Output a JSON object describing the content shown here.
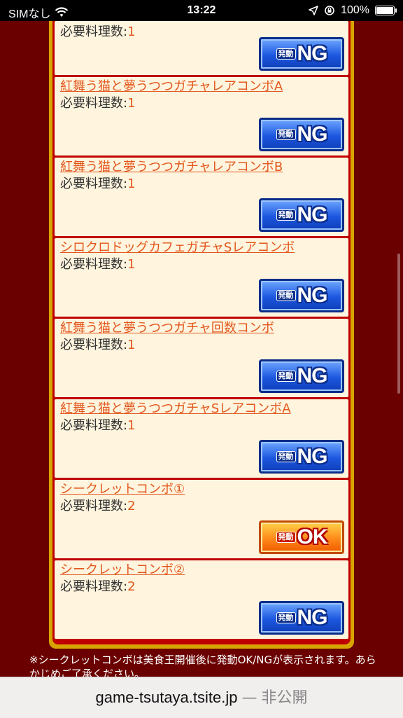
{
  "status_bar": {
    "carrier": "SIMなし",
    "time": "13:22",
    "battery": "100%",
    "wifi_icon": "wifi-icon",
    "location_icon": "location-arrow-icon",
    "rotation_lock_icon": "rotation-lock-icon"
  },
  "required_label": "必要料理数:",
  "cards": [
    {
      "title": "",
      "required": "1",
      "status_small": "発動",
      "status": "NG"
    },
    {
      "title": "紅舞う猫と夢うつつガチャレアコンボA",
      "required": "1",
      "status_small": "発動",
      "status": "NG"
    },
    {
      "title": "紅舞う猫と夢うつつガチャレアコンボB",
      "required": "1",
      "status_small": "発動",
      "status": "NG"
    },
    {
      "title": "シロクロドッグカフェガチャSレアコンボ",
      "required": "1",
      "status_small": "発動",
      "status": "NG"
    },
    {
      "title": "紅舞う猫と夢うつつガチャ回数コンボ",
      "required": "1",
      "status_small": "発動",
      "status": "NG"
    },
    {
      "title": "紅舞う猫と夢うつつガチャSレアコンボA",
      "required": "1",
      "status_small": "発動",
      "status": "NG"
    },
    {
      "title": "シークレットコンボ①",
      "required": "2",
      "status_small": "発動",
      "status": "OK"
    },
    {
      "title": "シークレットコンボ②",
      "required": "2",
      "status_small": "発動",
      "status": "NG"
    }
  ],
  "note": "※シークレットコンボは美食王開催後に発動OK/NGが表示されます。あらかじめご了承ください。",
  "url_bar": {
    "domain": "game-tsutaya.tsite.jp",
    "separator": "—",
    "private_label": "非公開"
  },
  "colors": {
    "background": "#6b0000",
    "panel_border": "#d7a400",
    "panel_red": "#c00000",
    "card_bg": "#fff4de",
    "link_orange": "#e2571c",
    "ng_blue": "#1c57e0",
    "ok_orange": "#ff8a1a"
  }
}
